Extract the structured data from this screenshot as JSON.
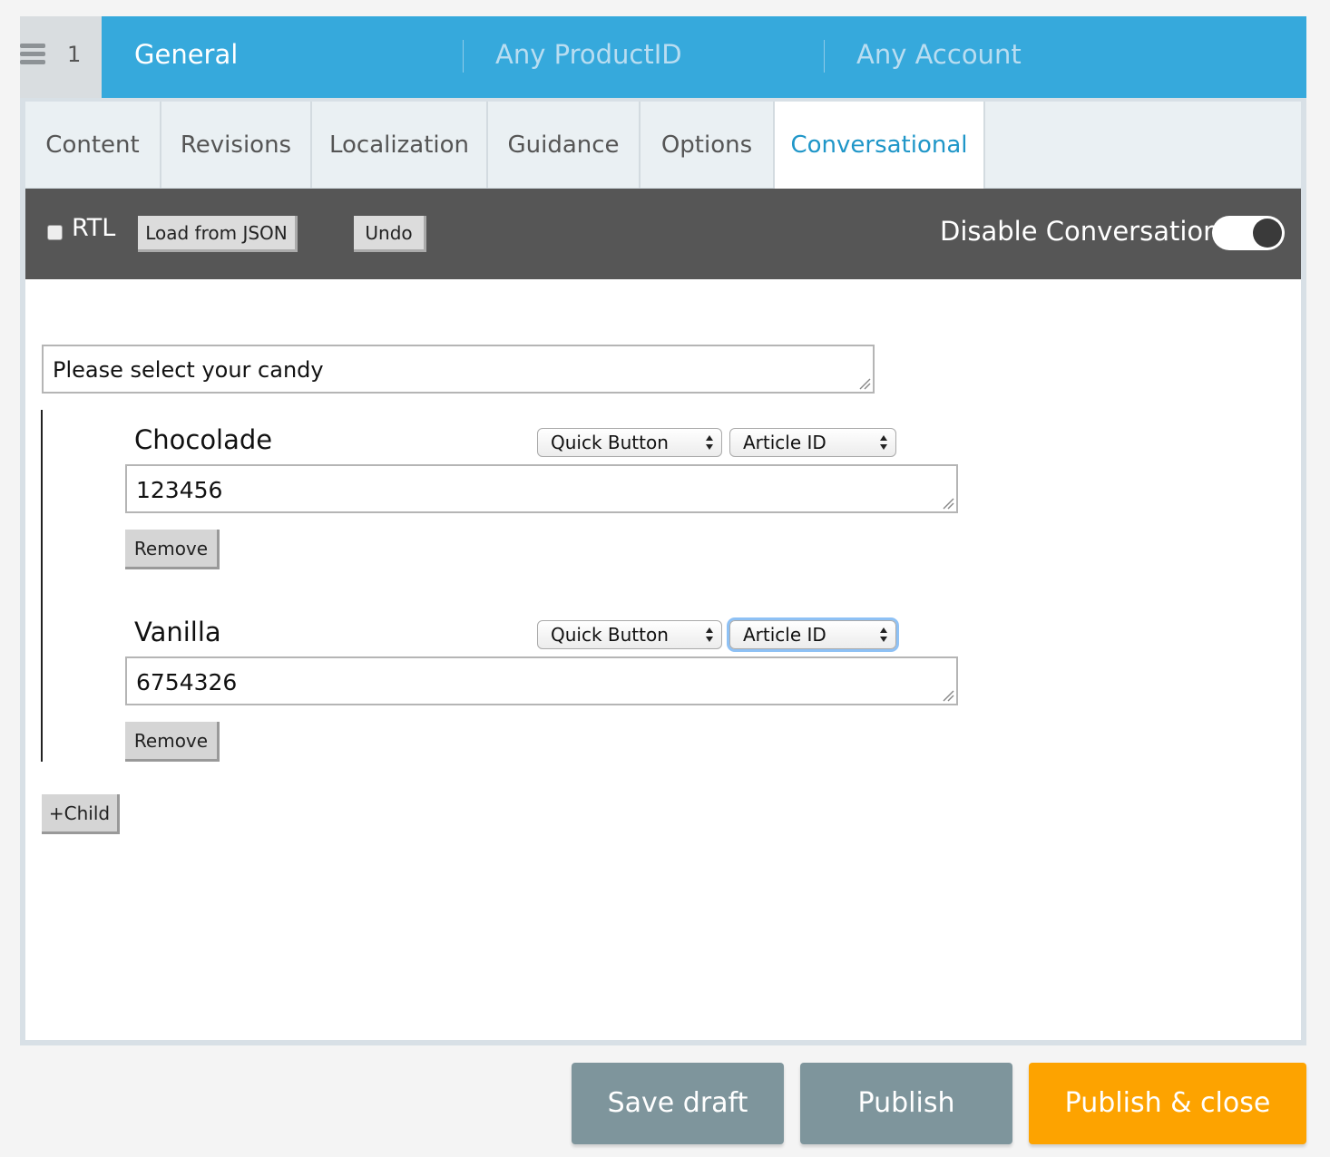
{
  "header": {
    "row_number": "1",
    "category": "General",
    "product": "Any ProductID",
    "account": "Any Account"
  },
  "tabs": [
    {
      "label": "Content",
      "active": false
    },
    {
      "label": "Revisions",
      "active": false
    },
    {
      "label": "Localization",
      "active": false
    },
    {
      "label": "Guidance",
      "active": false
    },
    {
      "label": "Options",
      "active": false
    },
    {
      "label": "Conversational",
      "active": true
    }
  ],
  "toolbar": {
    "rtl_label": "RTL",
    "rtl_checked": false,
    "load_json_label": "Load from JSON",
    "undo_label": "Undo",
    "disable_label": "Disable Conversation",
    "disable_on": true
  },
  "conversation": {
    "question": "Please select your candy",
    "children": [
      {
        "name": "Chocolade",
        "type": "Quick Button",
        "link_type": "Article ID",
        "value": "123456",
        "remove_label": "Remove"
      },
      {
        "name": "Vanilla",
        "type": "Quick Button",
        "link_type": "Article ID",
        "value": "6754326",
        "remove_label": "Remove"
      }
    ],
    "add_child_label": "+Child"
  },
  "footer": {
    "save_draft_label": "Save draft",
    "publish_label": "Publish",
    "publish_close_label": "Publish & close"
  },
  "colors": {
    "header_blue": "#36a9dc",
    "active_tab": "#1f96c8",
    "toolbar": "#565656",
    "secondary_button": "#7e959c",
    "primary_button": "#fda300"
  }
}
